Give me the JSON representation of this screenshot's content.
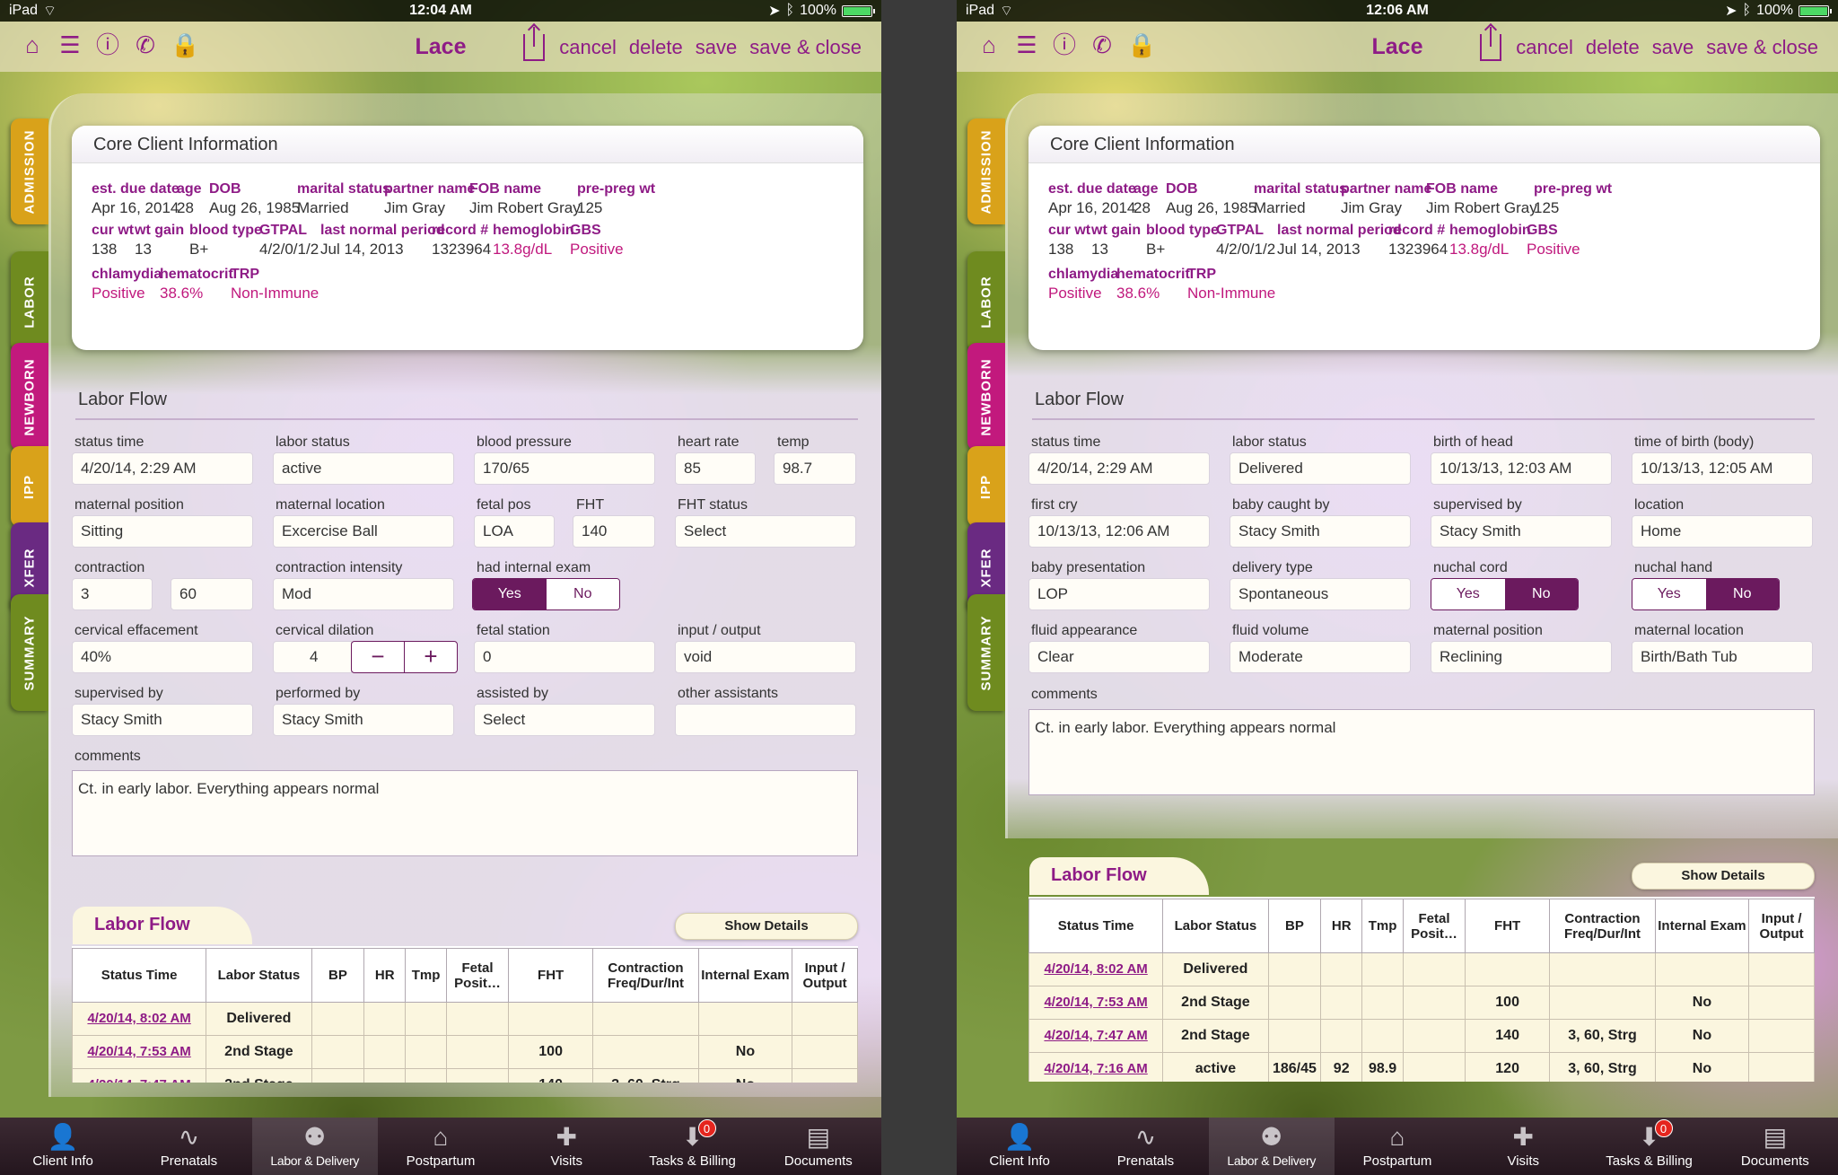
{
  "statusbar": {
    "device": "iPad",
    "battery": "100%",
    "time_left": "12:04 AM",
    "time_right": "12:06 AM"
  },
  "nav": {
    "title": "Lace",
    "cancel": "cancel",
    "delete": "delete",
    "save": "save",
    "save_close": "save & close"
  },
  "icons": [
    "home-icon",
    "list-icon",
    "info-icon",
    "phone-icon",
    "lock-icon",
    "share-icon"
  ],
  "sidetabs": [
    {
      "label": "ADMISSION",
      "color": "#d9a21a"
    },
    {
      "label": "LABOR",
      "color": "#6f8b1f"
    },
    {
      "label": "NEWBORN",
      "color": "#c2197d"
    },
    {
      "label": "IPP",
      "color": "#d9a21a"
    },
    {
      "label": "XFER",
      "color": "#6a2a82"
    },
    {
      "label": "SUMMARY",
      "color": "#6f8b1f"
    }
  ],
  "core": {
    "title": "Core Client Information",
    "row1": [
      {
        "l": "est. due date",
        "v": "Apr 16, 2014"
      },
      {
        "l": "age",
        "v": "28"
      },
      {
        "l": "DOB",
        "v": "Aug 26, 1985"
      },
      {
        "l": "marital status",
        "v": "Married"
      },
      {
        "l": "partner name",
        "v": "Jim Gray"
      },
      {
        "l": "FOB name",
        "v": "Jim Robert Gray"
      },
      {
        "l": "pre-preg wt",
        "v": "125"
      }
    ],
    "row2": [
      {
        "l": "cur wt",
        "v": "138"
      },
      {
        "l": "wt gain",
        "v": "13"
      },
      {
        "l": "blood type",
        "v": "B+"
      },
      {
        "l": "GTPAL",
        "v": "4/2/0/1/2"
      },
      {
        "l": "last normal period",
        "v": "Jul 14, 2013"
      },
      {
        "l": "record #",
        "v": "1323964"
      },
      {
        "l": "hemoglobin",
        "v": "13.8g/dL"
      },
      {
        "l": "GBS",
        "v": "Positive"
      }
    ],
    "row3": [
      {
        "l": "chlamydia",
        "v": "Positive"
      },
      {
        "l": "hematocrit",
        "v": "38.6%"
      },
      {
        "l": "TRP",
        "v": "Non-Immune"
      }
    ]
  },
  "left": {
    "section": "Labor Flow",
    "status_time_l": "status time",
    "status_time_v": "4/20/14, 2:29 AM",
    "labor_status_l": "labor status",
    "labor_status_v": "active",
    "bp_l": "blood pressure",
    "bp_v": "170/65",
    "hr_l": "heart rate",
    "hr_v": "85",
    "temp_l": "temp",
    "temp_v": "98.7",
    "mat_pos_l": "maternal position",
    "mat_pos_v": "Sitting",
    "mat_loc_l": "maternal location",
    "mat_loc_v": "Excercise Ball",
    "fetal_pos_l": "fetal pos",
    "fetal_pos_v": "LOA",
    "fht_l": "FHT",
    "fht_v": "140",
    "fht_status_l": "FHT status",
    "fht_status_v": "Select",
    "contraction_l": "contraction",
    "contraction_v1": "3",
    "contraction_v2": "60",
    "intensity_l": "contraction intensity",
    "intensity_v": "Mod",
    "internal_l": "had internal exam",
    "yes": "Yes",
    "no": "No",
    "effacement_l": "cervical effacement",
    "effacement_v": "40%",
    "dilation_l": "cervical dilation",
    "dilation_v": "4",
    "minus": "−",
    "plus": "+",
    "station_l": "fetal station",
    "station_v": "0",
    "io_l": "input / output",
    "io_v": "void",
    "supervised_l": "supervised by",
    "supervised_v": "Stacy Smith",
    "performed_l": "performed by",
    "performed_v": "Stacy Smith",
    "assisted_l": "assisted by",
    "assisted_v": "Select",
    "other_l": "other assistants",
    "other_v": "",
    "comments_l": "comments",
    "comments_v": "Ct. in early labor.  Everything appears normal"
  },
  "right": {
    "section": "Labor Flow",
    "status_time_l": "status time",
    "status_time_v": "4/20/14, 2:29 AM",
    "labor_status_l": "labor status",
    "labor_status_v": "Delivered",
    "birth_head_l": "birth of head",
    "birth_head_v": "10/13/13, 12:03 AM",
    "birth_body_l": "time of birth (body)",
    "birth_body_v": "10/13/13, 12:05 AM",
    "first_cry_l": "first cry",
    "first_cry_v": "10/13/13, 12:06 AM",
    "caught_l": "baby caught by",
    "caught_v": "Stacy Smith",
    "supervised_l": "supervised by",
    "supervised_v": "Stacy Smith",
    "location_l": "location",
    "location_v": "Home",
    "presentation_l": "baby presentation",
    "presentation_v": "LOP",
    "delivery_l": "delivery type",
    "delivery_v": "Spontaneous",
    "nuchal_cord_l": "nuchal cord",
    "nuchal_hand_l": "nuchal hand",
    "yes": "Yes",
    "no": "No",
    "fluid_app_l": "fluid appearance",
    "fluid_app_v": "Clear",
    "fluid_vol_l": "fluid volume",
    "fluid_vol_v": "Moderate",
    "mat_pos_l": "maternal position",
    "mat_pos_v": "Reclining",
    "mat_loc_l": "maternal location",
    "mat_loc_v": "Birth/Bath Tub",
    "comments_l": "comments",
    "comments_v": "Ct. in early labor.  Everything appears normal"
  },
  "table": {
    "tab": "Labor Flow",
    "show_details": "Show Details",
    "headers": [
      "Status Time",
      "Labor Status",
      "BP",
      "HR",
      "Tmp",
      "Fetal Posit…",
      "FHT",
      "Contraction Freq/Dur/Int",
      "Internal Exam",
      "Input / Output"
    ],
    "rows": [
      [
        "4/20/14, 8:02 AM",
        "Delivered",
        "",
        "",
        "",
        "",
        "",
        "",
        "",
        ""
      ],
      [
        "4/20/14, 7:53 AM",
        "2nd Stage",
        "",
        "",
        "",
        "",
        "100",
        "",
        "No",
        ""
      ],
      [
        "4/20/14, 7:47 AM",
        "2nd Stage",
        "",
        "",
        "",
        "",
        "140",
        "3, 60, Strg",
        "No",
        ""
      ],
      [
        "4/20/14, 7:16 AM",
        "active",
        "186/45",
        "92",
        "98.9",
        "",
        "120",
        "3, 60, Strg",
        "No",
        ""
      ]
    ]
  },
  "tabbar": {
    "items": [
      "Client Info",
      "Prenatals",
      "Labor & Delivery",
      "Postpartum",
      "Visits",
      "Tasks & Billing",
      "Documents"
    ],
    "badge": "0"
  }
}
